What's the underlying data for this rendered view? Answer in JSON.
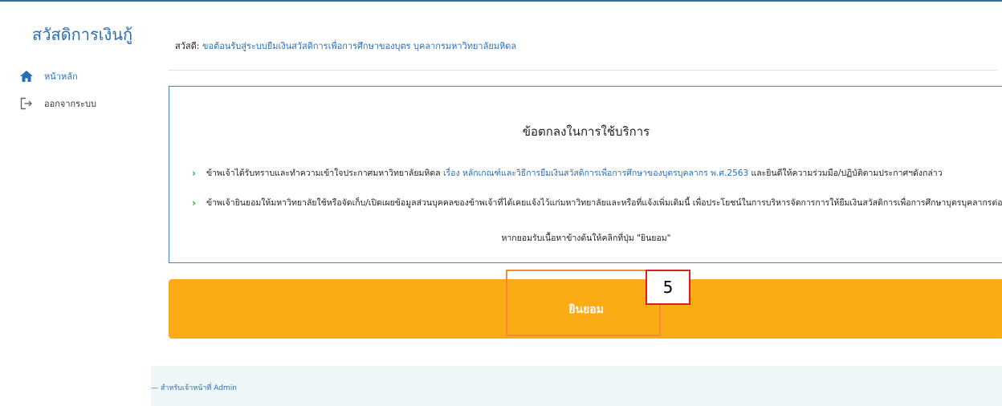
{
  "sidebar": {
    "brand": "สวัสดิการเงินกู้",
    "items": [
      {
        "label": "หน้าหลัก",
        "icon": "home-icon"
      },
      {
        "label": "ออกจากระบบ",
        "icon": "logout-icon"
      }
    ]
  },
  "header": {
    "greeting_prefix": "สวัสดี:",
    "greeting_text": "ขอต้อนรับสู่ระบบยืมเงินสวัสดิการเพื่อการศึกษาของบุตร บุคลากรมหาวิทยาลัยมหิดล"
  },
  "terms": {
    "title": "ข้อตกลงในการใช้บริการ",
    "item1_before": "ข้าพเจ้าได้รับทราบและทำความเข้าใจประกาศมหาวิทยาลัยมหิดล",
    "item1_link": "เรื่อง หลักเกณฑ์และวิธีการยืมเงินสวัสดิการเพื่อการศึกษาของบุตรบุคลากร พ.ศ.2563",
    "item1_after": "และยินดีให้ความร่วมมือ/ปฏิบัติตามประกาศฯดังกล่าว",
    "item2": "ข้าพเจ้ายินยอมให้มหาวิทยาลัยใช้หรือจัดเก็บ/เปิดเผยข้อมูลส่วนบุคคลของข้าพเจ้าที่ได้เคยแจ้งไว้แก่มหาวิทยาลัยและหรือที่แจ้งเพิ่มเติมนี้ เพื่อประโยชน์ในการบริหารจัดการการให้ยืมเงินสวัสดิการเพื่อการศึกษาบุตรบุคลากรต่อไป",
    "note": "หากยอมรับเนื้อหาข้างต้นให้คลิกที่ปุ่ม \"ยินยอม\""
  },
  "accept_button": {
    "label": "ยินยอม"
  },
  "annotation": {
    "step": "5"
  },
  "footer": {
    "text": "— สำหรับเจ้าหน้าที่ Admin"
  },
  "colors": {
    "accent": "#2a6fb5",
    "button": "#fbab14",
    "highlight": "#f08a3c",
    "badge_border": "#d81f26"
  }
}
